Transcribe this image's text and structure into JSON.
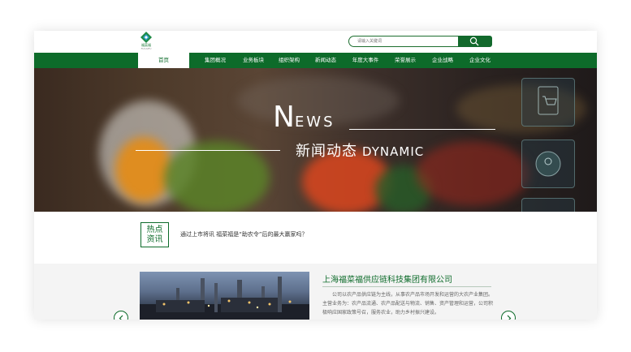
{
  "logo": {
    "name": "福菜福",
    "subtitle": "FUCAIFU"
  },
  "search": {
    "placeholder": "请输入关键词"
  },
  "nav": {
    "items": [
      {
        "label": "首页",
        "active": true
      },
      {
        "label": "集团概况",
        "active": false
      },
      {
        "label": "业务板块",
        "active": false
      },
      {
        "label": "组织架构",
        "active": false
      },
      {
        "label": "新闻动态",
        "active": false
      },
      {
        "label": "年度大事件",
        "active": false
      },
      {
        "label": "荣誉展示",
        "active": false
      },
      {
        "label": "企业战略",
        "active": false
      },
      {
        "label": "企业文化",
        "active": false
      }
    ]
  },
  "banner": {
    "title_initial": "N",
    "title_rest": "EWS",
    "subtitle_cn": "新闻动态",
    "subtitle_en": "DYNAMIC"
  },
  "hot": {
    "badge_line1": "热点",
    "badge_line2": "资讯",
    "headline": "通过上市将讯 福菜福是“助农令”后的最大赢家吗？"
  },
  "company": {
    "name": "上海福菜福供应链科技集团有限公司",
    "description": "公司以农产品供应链为主线，从事农产品市场开发和运营的大农产业集团。主营业务为：农产品流通、农产品配送与物流、销售、资产管理和运营，公司积极响应国家政策号召，服务农业，助力乡村振兴建设。"
  },
  "colors": {
    "brand_green": "#0d6b2a"
  }
}
